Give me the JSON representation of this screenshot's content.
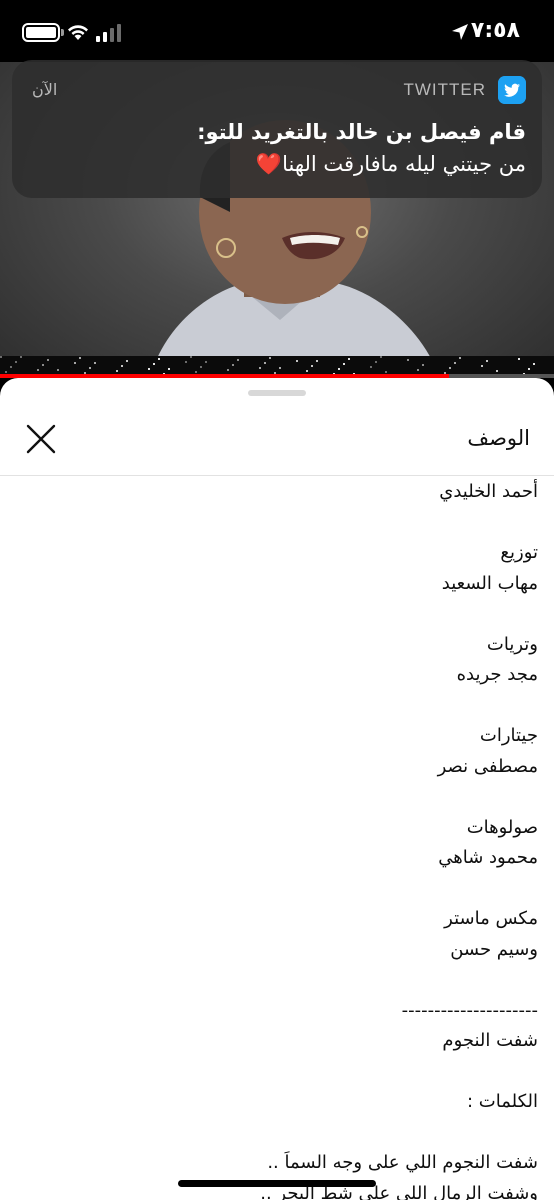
{
  "status_bar": {
    "time": "٧:٥٨",
    "icons": [
      "location-arrow-icon",
      "signal-icon",
      "wifi-icon",
      "battery-icon"
    ]
  },
  "video": {
    "progress_fraction": 0.81,
    "progress_color": "#ff0000"
  },
  "notification": {
    "app_name": "TWITTER",
    "app_icon": "twitter-bird-icon",
    "app_color": "#1da1f2",
    "time": "الآن",
    "title": "قام فيصل بن خالد بالتغريد للتو:",
    "body": "من جيتني ليله مافارقت الهنا",
    "body_emoji": "❤️"
  },
  "sheet": {
    "title": "الوصف",
    "close_icon": "close-icon",
    "lines": [
      "أحمد الخليدي",
      "",
      "توزيع",
      "مهاب السعيد",
      "",
      "وتريات",
      "مجد جريده",
      "",
      "جيتارات",
      "مصطفى نصر",
      "",
      "صولوهات",
      "محمود شاهي",
      "",
      "مكس ماستر",
      "وسيم حسن",
      "",
      "---------------------",
      "شفت النجوم",
      "",
      "الكلمات :",
      "",
      "شفت النجوم اللي على وجه السماَ ..",
      "وشفت الرمال اللي على شط البحر .."
    ]
  }
}
